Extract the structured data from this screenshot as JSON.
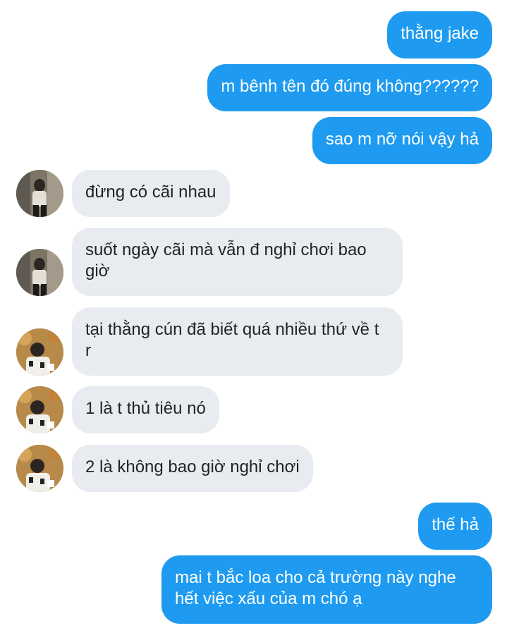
{
  "chat": {
    "messages": [
      {
        "direction": "outgoing",
        "text": "thằng jake"
      },
      {
        "direction": "outgoing",
        "text": "m bênh tên đó đúng không??????"
      },
      {
        "direction": "outgoing",
        "text": "sao m nỡ nói vậy hả"
      },
      {
        "direction": "incoming",
        "avatar": "avatar-1",
        "text": "đừng có cãi nhau"
      },
      {
        "direction": "incoming",
        "avatar": "avatar-1",
        "text": "suốt ngày cãi mà vẫn đ nghỉ chơi bao giờ"
      },
      {
        "direction": "incoming",
        "avatar": "avatar-2",
        "text": "tại thằng cún đã biết quá nhiều thứ về t r"
      },
      {
        "direction": "incoming",
        "avatar": "avatar-2",
        "text": "1 là t thủ tiêu nó"
      },
      {
        "direction": "incoming",
        "avatar": "avatar-2",
        "text": "2 là không bao giờ nghỉ chơi"
      },
      {
        "direction": "outgoing",
        "text": "thế hả"
      },
      {
        "direction": "outgoing",
        "text": "mai t bắc loa cho cả trường này nghe hết việc xấu của m chó ạ"
      }
    ]
  },
  "colors": {
    "outgoing_bubble": "#1e9bf0",
    "incoming_bubble": "#e8ecf0",
    "outgoing_text": "#ffffff",
    "incoming_text": "#1f2328"
  }
}
